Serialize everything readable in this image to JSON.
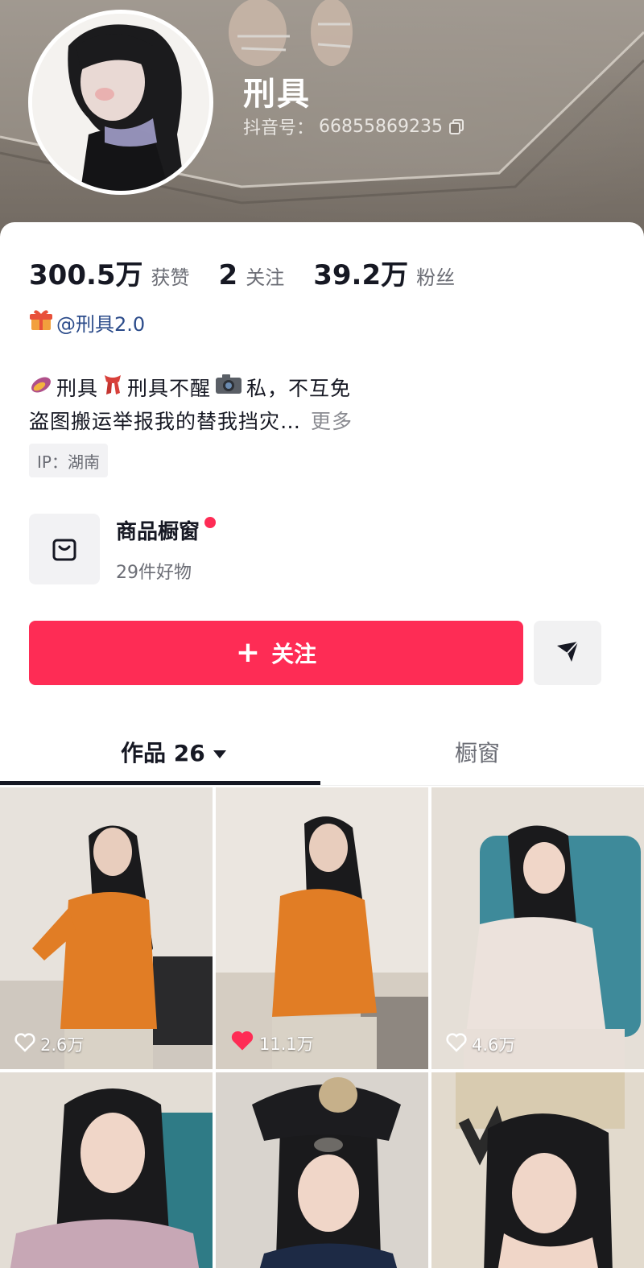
{
  "profile": {
    "username": "刑具",
    "douyin_id_label": "抖音号：",
    "douyin_id": "66855869235"
  },
  "stats": {
    "likes_value": "300.5万",
    "likes_label": "获赞",
    "following_value": "2",
    "following_label": "关注",
    "followers_value": "39.2万",
    "followers_label": "粉丝"
  },
  "linked_account": {
    "text": "@刑具2.0",
    "icon": "gift-icon"
  },
  "bio": {
    "line1_part1": "刑具",
    "line1_part2": "刑具不醒",
    "line1_part3": "私，不互免",
    "line2": "盗图搬运举报我的替我挡灾…",
    "more": "更多",
    "emojis": [
      "sweet-potato-emoji",
      "scarf-emoji",
      "camera-emoji"
    ]
  },
  "ip": "IP：湖南",
  "shop": {
    "title": "商品橱窗",
    "subtitle": "29件好物",
    "icon": "shopping-bag-icon"
  },
  "actions": {
    "follow_label": "关注",
    "plus": "+",
    "dm_icon": "send-icon"
  },
  "tabs": {
    "works_label": "作品 26",
    "window_label": "橱窗"
  },
  "videos": [
    {
      "likes": "2.6万",
      "liked": false,
      "outfit": "orange-shirt"
    },
    {
      "likes": "11.1万",
      "liked": true,
      "outfit": "orange-shirt"
    },
    {
      "likes": "4.6万",
      "liked": false,
      "outfit": "white-shirt"
    },
    {
      "likes": "",
      "liked": false,
      "outfit": "floral-qipao"
    },
    {
      "likes": "",
      "liked": false,
      "outfit": "police-cap"
    },
    {
      "likes": "",
      "liked": false,
      "outfit": "dark-top"
    }
  ],
  "colors": {
    "accent": "#fe2c55",
    "text_primary": "#161823",
    "text_secondary": "#6b6d75",
    "link": "#2b4b8a"
  }
}
